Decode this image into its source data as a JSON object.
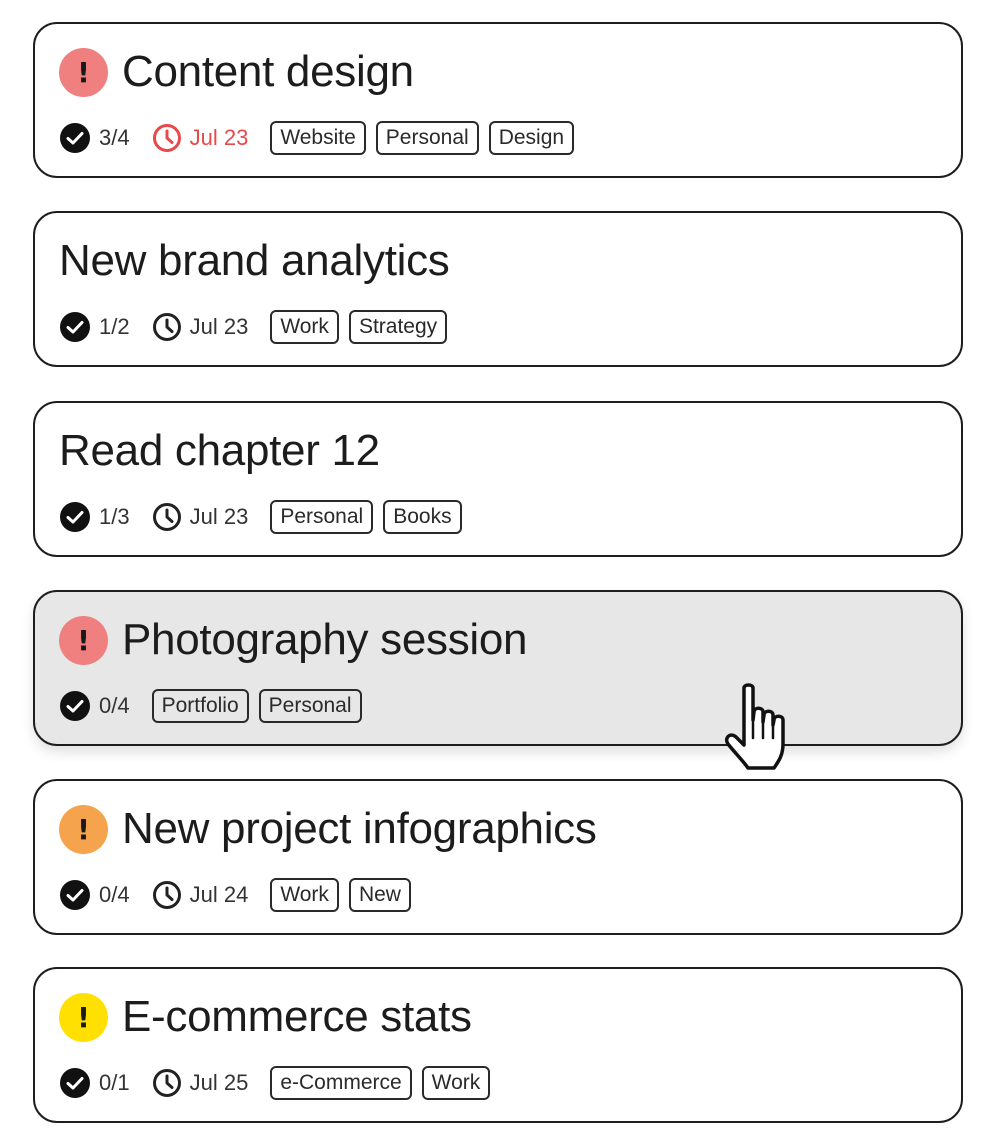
{
  "colors": {
    "priority_high": "#f08080",
    "priority_medium": "#f5a34c",
    "priority_low": "#ffe000",
    "overdue": "#e8494a",
    "hover_background": "#e7e7e7"
  },
  "tasks": [
    {
      "priority_symbol": "!",
      "priority_level": "high",
      "title": "Content design",
      "subtasks": "3/4",
      "due": "Jul 23",
      "overdue": true,
      "tags": [
        "Website",
        "Personal",
        "Design"
      ]
    },
    {
      "title": "New brand analytics",
      "subtasks": "1/2",
      "due": "Jul 23",
      "tags": [
        "Work",
        "Strategy"
      ]
    },
    {
      "title": "Read chapter 12",
      "subtasks": "1/3",
      "due": "Jul 23",
      "tags": [
        "Personal",
        "Books"
      ]
    },
    {
      "priority_symbol": "!",
      "priority_level": "high",
      "title": "Photography session",
      "subtasks": "0/4",
      "hovered": true,
      "tags": [
        "Portfolio",
        "Personal"
      ]
    },
    {
      "priority_symbol": "!",
      "priority_level": "medium",
      "title": "New project infographics",
      "subtasks": "0/4",
      "due": "Jul 24",
      "tags": [
        "Work",
        "New"
      ]
    },
    {
      "priority_symbol": "!",
      "priority_level": "low",
      "title": "E-commerce stats",
      "subtasks": "0/1",
      "due": "Jul 25",
      "tags": [
        "e-Commerce",
        "Work"
      ]
    }
  ],
  "icons": {
    "subtasks": "check-circle-icon",
    "due": "clock-icon",
    "pointer": "hand-pointer-icon"
  }
}
